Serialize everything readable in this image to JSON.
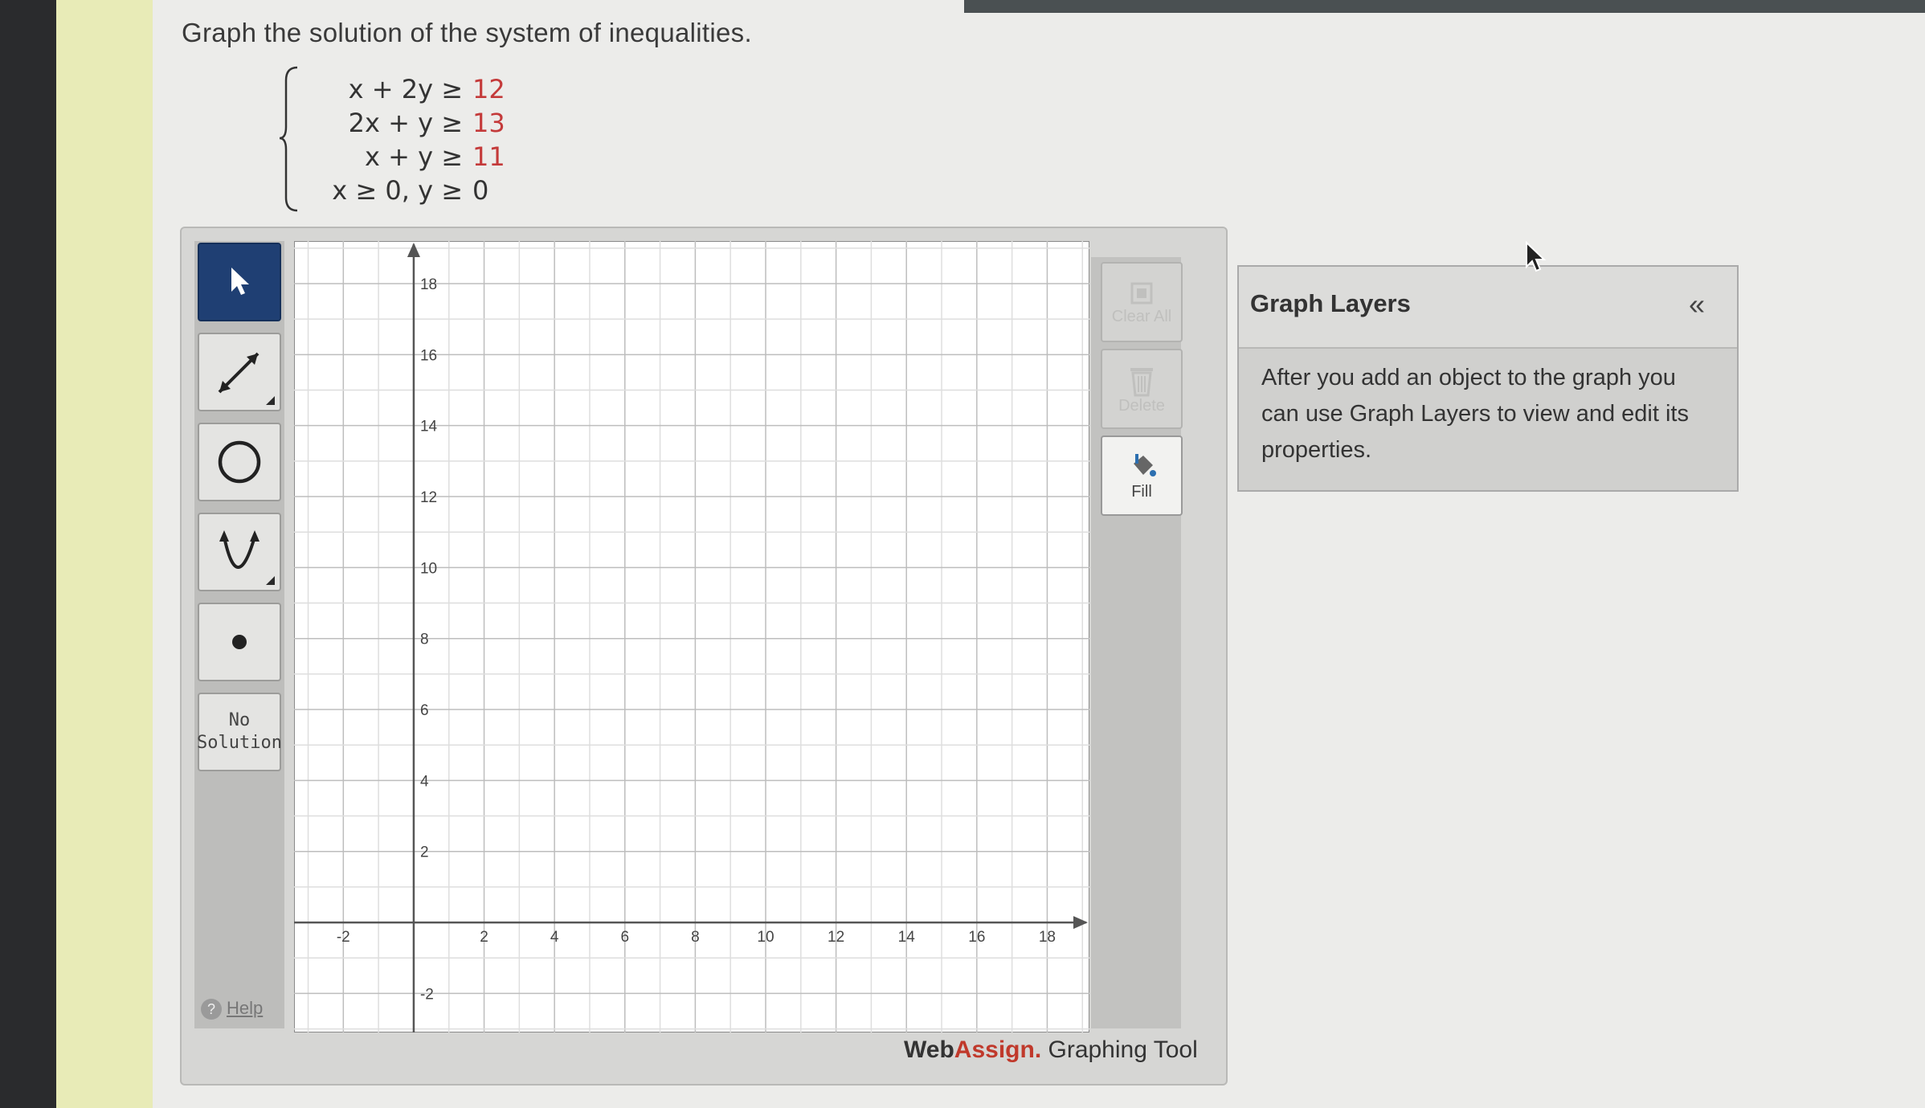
{
  "question": "Graph the solution of the system of inequalities.",
  "system": [
    {
      "lhs": "x + 2y ≥",
      "rhs": "12"
    },
    {
      "lhs": "2x +   y ≥",
      "rhs": "13"
    },
    {
      "lhs": "x +   y ≥",
      "rhs": "11"
    },
    {
      "lhs": "x ≥ 0,  y ≥",
      "rhs": "0"
    }
  ],
  "toolbar": {
    "tools": [
      {
        "name": "pointer-tool",
        "icon": "arrow-cursor-icon",
        "active": true
      },
      {
        "name": "line-tool",
        "icon": "line-segment-icon",
        "active": false
      },
      {
        "name": "circle-tool",
        "icon": "circle-icon",
        "active": false
      },
      {
        "name": "parabola-tool",
        "icon": "parabola-icon",
        "active": false
      },
      {
        "name": "point-tool",
        "icon": "point-icon",
        "active": false
      }
    ],
    "no_solution_label": "No Solution",
    "help_label": "Help"
  },
  "graph": {
    "x_ticks": [
      "-2",
      "2",
      "4",
      "6",
      "8",
      "10",
      "12",
      "14",
      "16",
      "18"
    ],
    "y_ticks": [
      "18",
      "16",
      "14",
      "12",
      "10",
      "8",
      "6",
      "4",
      "2",
      "-2"
    ]
  },
  "actions": {
    "clear_all_label": "Clear All",
    "delete_label": "Delete",
    "fill_label": "Fill"
  },
  "branding": {
    "web": "Web",
    "assign": "Assign.",
    "tool": " Graphing Tool"
  },
  "layers": {
    "title": "Graph Layers",
    "collapse": "«",
    "description": "After you add an object to the graph you can use Graph Layers to view and edit its properties."
  }
}
